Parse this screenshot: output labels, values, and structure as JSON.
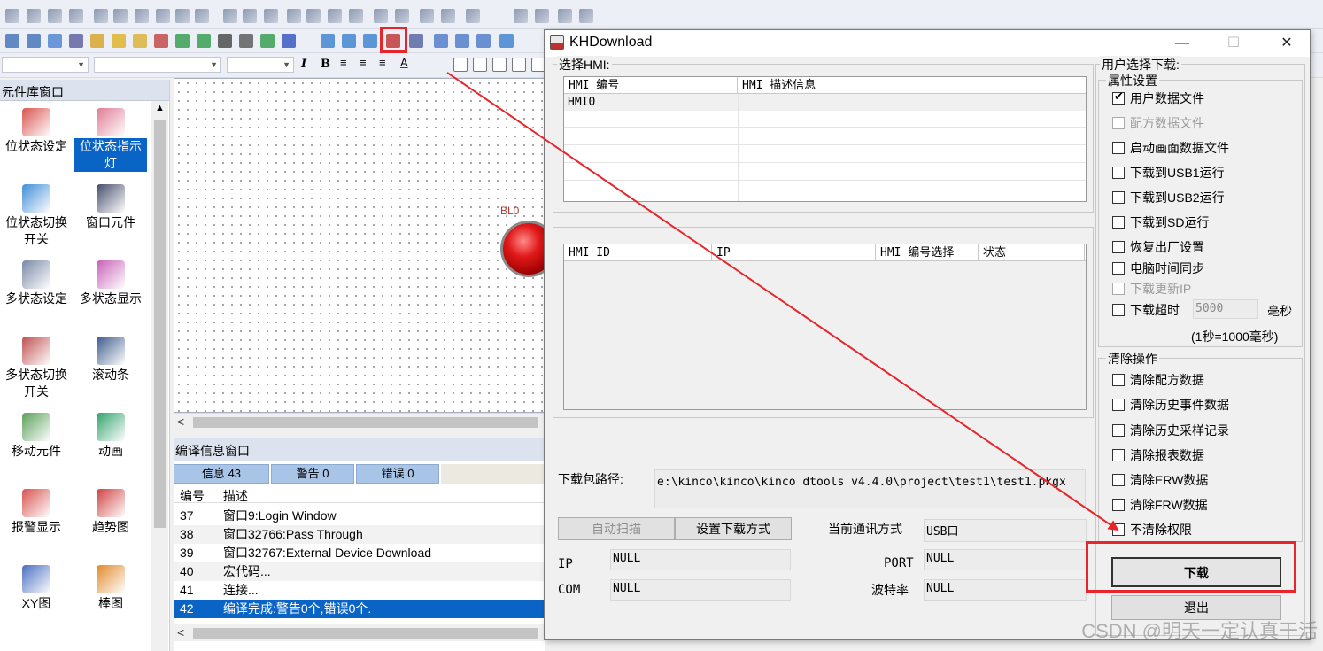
{
  "library_panel": {
    "title": "元件库窗口",
    "close": "×",
    "items": [
      {
        "label": "位状态设定",
        "icon": "bit-state-set-icon",
        "color": "#d9534f"
      },
      {
        "label": "位状态指示灯",
        "icon": "bit-indicator-lamp-icon",
        "color": "#e07a93",
        "selected": true
      },
      {
        "label": "位状态切换开关",
        "icon": "bit-toggle-switch-icon",
        "color": "#3f8fd8"
      },
      {
        "label": "窗口元件",
        "icon": "window-element-icon",
        "color": "#444c6a"
      },
      {
        "label": "多状态设定",
        "icon": "multi-state-set-icon",
        "color": "#7a8aa8"
      },
      {
        "label": "多状态显示",
        "icon": "multi-state-display-icon",
        "color": "#c85fb8"
      },
      {
        "label": "多状态切换开关",
        "icon": "multi-state-switch-icon",
        "color": "#c05050"
      },
      {
        "label": "滚动条",
        "icon": "scrollbar-icon",
        "color": "#3c5a8c"
      },
      {
        "label": "移动元件",
        "icon": "move-element-icon",
        "color": "#5aa05a"
      },
      {
        "label": "动画",
        "icon": "animation-icon",
        "color": "#2fa36b"
      },
      {
        "label": "报警显示",
        "icon": "alarm-display-icon",
        "color": "#d9534f"
      },
      {
        "label": "趋势图",
        "icon": "trend-chart-icon",
        "color": "#d04040"
      },
      {
        "label": "XY图",
        "icon": "xy-chart-icon",
        "color": "#4a6fc0"
      },
      {
        "label": "棒图",
        "icon": "bar-chart-icon",
        "color": "#e08a2a"
      }
    ]
  },
  "canvas": {
    "element_label": "BL0"
  },
  "compile_window": {
    "title": "编译信息窗口",
    "tabs": [
      {
        "label": "信息  43"
      },
      {
        "label": "警告  0"
      },
      {
        "label": "错误  0"
      }
    ],
    "columns": [
      "编号",
      "描述"
    ],
    "rows": [
      {
        "no": "37",
        "desc": "窗口9:Login Window"
      },
      {
        "no": "38",
        "desc": "窗口32766:Pass Through"
      },
      {
        "no": "39",
        "desc": "窗口32767:External Device Download"
      },
      {
        "no": "40",
        "desc": "宏代码..."
      },
      {
        "no": "41",
        "desc": "连接..."
      },
      {
        "no": "42",
        "desc": "编译完成:警告0个,错误0个."
      }
    ]
  },
  "dialog": {
    "title": "KHDownload",
    "controls": {
      "minimize": "—",
      "maximize": "☐",
      "close": "✕"
    },
    "select_hmi": {
      "group_label": "选择HMI:",
      "columns": [
        "HMI 编号",
        "HMI 描述信息"
      ],
      "rows": [
        {
          "id": "HMI0",
          "desc": ""
        }
      ]
    },
    "scan_list": {
      "columns": [
        "HMI ID",
        "IP",
        "HMI 编号选择",
        "状态"
      ]
    },
    "package_path": {
      "label": "下载包路径:",
      "value": "e:\\kinco\\kinco\\kinco dtools v4.4.0\\project\\test1\\test1.pkgx"
    },
    "auto_scan_button": "自动扫描",
    "set_download_mode_button": "设置下载方式",
    "ip": {
      "label": "IP",
      "value": "NULL"
    },
    "com": {
      "label": "COM",
      "value": "NULL"
    },
    "comm_mode": {
      "label": "当前通讯方式",
      "value": "USB口"
    },
    "port": {
      "label": "PORT",
      "value": "NULL"
    },
    "baud": {
      "label": "波特率",
      "value": "NULL"
    },
    "user_select_label": "用户选择下载:",
    "properties": {
      "group_label": "属性设置",
      "options": [
        {
          "label": "用户数据文件",
          "checked": true,
          "disabled": false
        },
        {
          "label": "配方数据文件",
          "checked": false,
          "disabled": true
        },
        {
          "label": "启动画面数据文件",
          "checked": false,
          "disabled": false
        },
        {
          "label": "下载到USB1运行",
          "checked": false,
          "disabled": false
        },
        {
          "label": "下载到USB2运行",
          "checked": false,
          "disabled": false
        },
        {
          "label": "下载到SD运行",
          "checked": false,
          "disabled": false
        },
        {
          "label": "恢复出厂设置",
          "checked": false,
          "disabled": false
        },
        {
          "label": "电脑时间同步",
          "checked": false,
          "disabled": false
        },
        {
          "label": "下载更新IP",
          "checked": false,
          "disabled": true
        }
      ],
      "timeout": {
        "label": "下载超时",
        "value": "5000",
        "unit": "毫秒",
        "hint": "(1秒=1000毫秒)"
      }
    },
    "clear_ops": {
      "group_label": "清除操作",
      "options": [
        {
          "label": "清除配方数据",
          "checked": false
        },
        {
          "label": "清除历史事件数据",
          "checked": false
        },
        {
          "label": "清除历史采样记录",
          "checked": false
        },
        {
          "label": "清除报表数据",
          "checked": false
        },
        {
          "label": "清除ERW数据",
          "checked": false
        },
        {
          "label": "清除FRW数据",
          "checked": false
        },
        {
          "label": "不清除权限",
          "checked": false
        }
      ]
    },
    "download_button": "下载",
    "exit_button": "退出"
  },
  "watermark": "CSDN @明天一定认真干活",
  "colors": {
    "highlight_red": "#e8262a",
    "selection_blue": "#0a64c6",
    "tab_blue": "#a8c4e6",
    "lamp_red": "#d41010"
  }
}
